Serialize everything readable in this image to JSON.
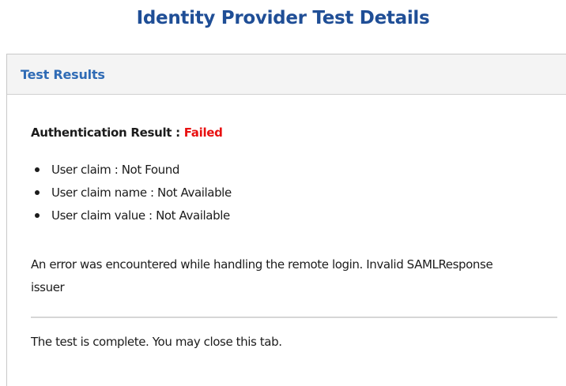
{
  "page": {
    "title": "Identity Provider Test Details"
  },
  "panel": {
    "header_title": "Test Results",
    "auth_label": "Authentication Result : ",
    "auth_status": "Failed",
    "claims": [
      {
        "text": "User claim : Not Found"
      },
      {
        "text": "User claim name : Not Available"
      },
      {
        "text": "User claim value : Not Available"
      }
    ],
    "error_message": "An error was encountered while handling the remote login. Invalid SAMLResponse issuer",
    "complete_message": "The test is complete. You may close this tab."
  },
  "colors": {
    "title": "#1f4e96",
    "header_title": "#2f6bb5",
    "failed_status": "#e81010",
    "header_background": "#f4f4f4"
  }
}
